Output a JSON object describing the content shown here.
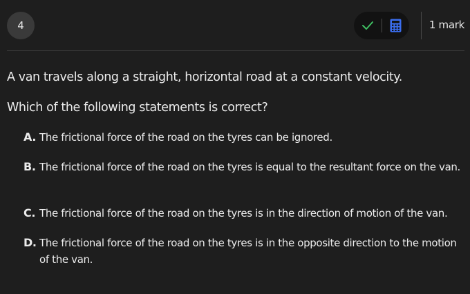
{
  "header": {
    "question_number": "4",
    "marks": "1 mark",
    "tools": [
      {
        "icon": "check-icon",
        "color": "#3fbf62"
      },
      {
        "icon": "calculator-icon",
        "color": "#3b6ef0"
      }
    ]
  },
  "question": {
    "stem_line1": "A van travels along a straight, horizontal road at a constant velocity.",
    "stem_line2": "Which of the following statements is correct?",
    "options": [
      {
        "letter": "A.",
        "text": "The frictional force of the road on the tyres can be ignored."
      },
      {
        "letter": "B.",
        "text": "The frictional force of the road on the tyres is equal to the resultant force on the van."
      },
      {
        "letter": "C.",
        "text": "The frictional force of the road on the tyres is in the direction of motion of the van."
      },
      {
        "letter": "D.",
        "text": "The frictional force of the road on the tyres is in the opposite direction to the motion of the van."
      }
    ]
  }
}
